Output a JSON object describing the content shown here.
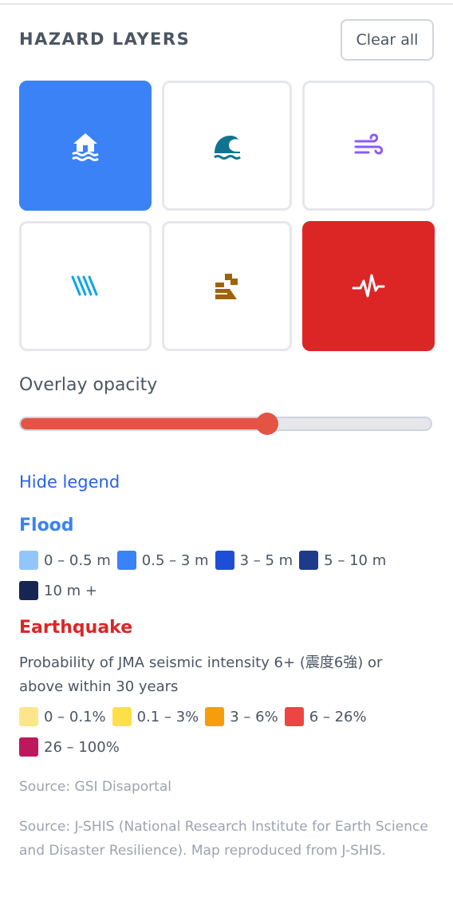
{
  "header": {
    "title": "HAZARD LAYERS",
    "clear_label": "Clear all"
  },
  "layers": [
    {
      "icon": "house-flood-icon",
      "active": true,
      "color": "#3b82f6"
    },
    {
      "icon": "tsunami-wave-icon",
      "active": false,
      "color": "#0e7490"
    },
    {
      "icon": "wind-icon",
      "active": false,
      "color": "#8b5cf6"
    },
    {
      "icon": "rain-icon",
      "active": false,
      "color": "#0ea5e9"
    },
    {
      "icon": "landslide-icon",
      "active": false,
      "color": "#a16207"
    },
    {
      "icon": "seismic-pulse-icon",
      "active": true,
      "color": "#dc2626"
    }
  ],
  "opacity": {
    "label": "Overlay opacity",
    "value_fraction": 0.6
  },
  "legend_toggle": "Hide legend",
  "flood": {
    "title": "Flood",
    "items": [
      {
        "label": "0 – 0.5 m",
        "color": "#93c5fd"
      },
      {
        "label": "0.5 – 3 m",
        "color": "#3b82f6"
      },
      {
        "label": "3 – 5 m",
        "color": "#1d4ed8"
      },
      {
        "label": "5 – 10 m",
        "color": "#1e3a8a"
      },
      {
        "label": "10 m +",
        "color": "#172554"
      }
    ]
  },
  "earthquake": {
    "title": "Earthquake",
    "description": "Probability of JMA seismic intensity 6+ (震度6強) or above within 30 years",
    "items": [
      {
        "label": "0 – 0.1%",
        "color": "#fde68a"
      },
      {
        "label": "0.1 – 3%",
        "color": "#fde047"
      },
      {
        "label": "3 – 6%",
        "color": "#f59e0b"
      },
      {
        "label": "6 – 26%",
        "color": "#ef4444"
      },
      {
        "label": "26 – 100%",
        "color": "#be185d"
      }
    ]
  },
  "sources": [
    "Source: GSI Disaportal",
    "Source: J-SHIS (National Research Institute for Earth Science and Disaster Resilience). Map reproduced from J-SHIS."
  ]
}
